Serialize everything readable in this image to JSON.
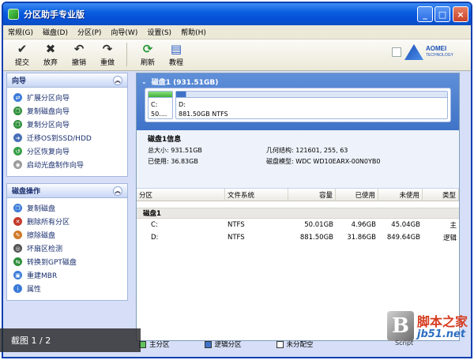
{
  "window": {
    "title": "分区助手专业版",
    "min": "_",
    "max": "□",
    "close": "×"
  },
  "menu": [
    "常规(G)",
    "磁盘(D)",
    "分区(P)",
    "向导(W)",
    "设置(S)",
    "帮助(H)"
  ],
  "toolbar": {
    "tools": [
      {
        "label": "提交",
        "icon": "check-icon"
      },
      {
        "label": "放弃",
        "icon": "x-icon"
      },
      {
        "label": "撤销",
        "icon": "undo-icon"
      },
      {
        "label": "重做",
        "icon": "redo-icon"
      },
      {
        "label": "刷新",
        "icon": "refresh-icon"
      },
      {
        "label": "教程",
        "icon": "tutorial-icon"
      }
    ],
    "logo": {
      "name": "AOMEI",
      "sub": "TECHNOLOGY"
    }
  },
  "wizard_panel": {
    "title": "向导",
    "items": [
      "扩展分区向导",
      "复制磁盘向导",
      "复制分区向导",
      "迁移OS到SSD/HDD",
      "分区恢复向导",
      "启动光盘制作向导"
    ]
  },
  "disk_ops_panel": {
    "title": "磁盘操作",
    "items": [
      "复制磁盘",
      "删除所有分区",
      "擦除磁盘",
      "坏扇区检测",
      "转换到GPT磁盘",
      "重建MBR",
      "属性"
    ]
  },
  "disk_map": {
    "title": "磁盘1 (931.51GB)",
    "partitions": [
      {
        "name": "C:",
        "size": "50....",
        "used_fraction": 0.1
      },
      {
        "name": "D:",
        "size": "881.50GB NTFS",
        "used_fraction": 0.036
      }
    ]
  },
  "disk_info": {
    "title": "磁盘1信息",
    "total": "总大小: 931.51GB",
    "geometry": "几何结构: 121601, 255, 63",
    "used": "已使用: 36.83GB",
    "model": "磁盘模型: WDC WD10EARX-00N0YB0"
  },
  "table": {
    "headers": [
      "分区",
      "文件系统",
      "容量",
      "已使用",
      "未使用",
      "类型"
    ],
    "group": "磁盘1",
    "rows": [
      {
        "partition": "C:",
        "fs": "NTFS",
        "capacity": "50.01GB",
        "used": "4.96GB",
        "free": "45.04GB",
        "type": "主"
      },
      {
        "partition": "D:",
        "fs": "NTFS",
        "capacity": "881.50GB",
        "used": "31.86GB",
        "free": "849.64GB",
        "type": "逻辑"
      }
    ]
  },
  "legend": [
    "主分区",
    "逻辑分区",
    "未分配空"
  ],
  "overlay": {
    "caption": "截图 1 / 2"
  },
  "watermark": {
    "cn": "脚本之家",
    "en": "jb51.net",
    "script": "Script"
  },
  "colors": {
    "primary_partition": "#5fc35a",
    "logical_partition": "#3f73c7",
    "title_bar": "#0a5fe0"
  }
}
